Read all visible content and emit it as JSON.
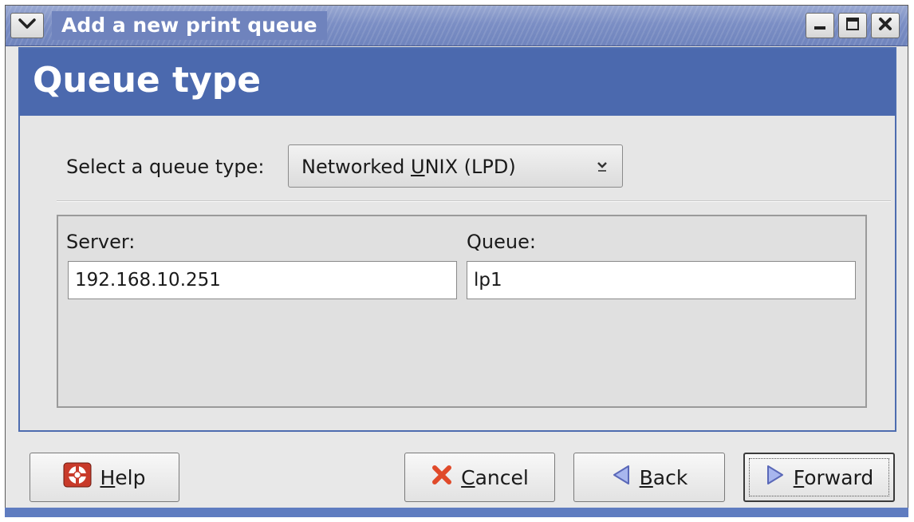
{
  "window": {
    "title": "Add a new print queue"
  },
  "page": {
    "title": "Queue type"
  },
  "queue_type": {
    "label": "Select a queue type:",
    "selected": "Networked UNIX (LPD)",
    "selected_pre": "Networked ",
    "selected_mnemonic": "U",
    "selected_post": "NIX (LPD)"
  },
  "server": {
    "label": "Server:",
    "value": "192.168.10.251"
  },
  "queue": {
    "label": "Queue:",
    "value": "lp1"
  },
  "buttons": {
    "help": {
      "mnemonic": "H",
      "rest": "elp"
    },
    "cancel": {
      "mnemonic": "C",
      "rest": "ancel"
    },
    "back": {
      "mnemonic": "B",
      "rest": "ack"
    },
    "forward": {
      "mnemonic": "F",
      "rest": "orward"
    }
  },
  "colors": {
    "header": "#4b69ae",
    "titlebar": "#7b8ec4",
    "cancel_icon": "#e04a2a",
    "nav_icon": "#8a9ad8"
  },
  "icons": {
    "window_menu": "chevron-down-icon",
    "minimize": "minimize-icon",
    "maximize": "maximize-icon",
    "close": "close-icon",
    "dropdown": "dropdown-arrow-icon",
    "help": "lifebuoy-icon",
    "cancel": "cancel-x-icon",
    "back": "back-arrow-icon",
    "forward": "forward-arrow-icon"
  }
}
